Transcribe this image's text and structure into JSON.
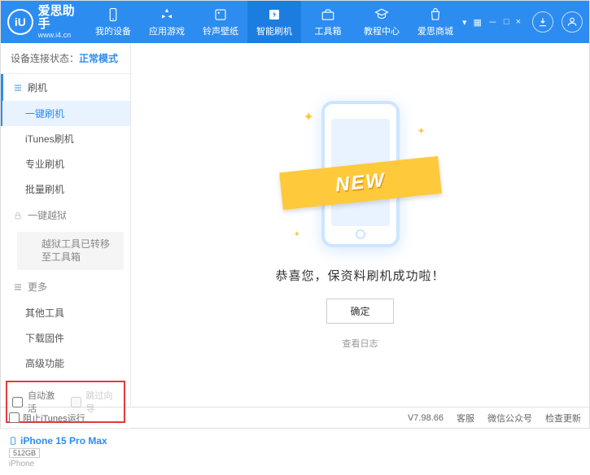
{
  "app": {
    "name": "爱思助手",
    "url": "www.i4.cn",
    "logoLetter": "iU"
  },
  "nav": {
    "items": [
      {
        "label": "我的设备"
      },
      {
        "label": "应用游戏"
      },
      {
        "label": "铃声壁纸"
      },
      {
        "label": "智能刷机"
      },
      {
        "label": "工具箱"
      },
      {
        "label": "教程中心"
      },
      {
        "label": "爱思商城"
      }
    ],
    "activeIndex": 3
  },
  "sidebar": {
    "connLabel": "设备连接状态：",
    "connMode": "正常模式",
    "group1": {
      "header": "刷机",
      "items": [
        "一键刷机",
        "iTunes刷机",
        "专业刷机",
        "批量刷机"
      ],
      "activeIndex": 0
    },
    "jailbreak": {
      "header": "一键越狱",
      "note": "越狱工具已转移至工具箱"
    },
    "more": {
      "header": "更多",
      "items": [
        "其他工具",
        "下载固件",
        "高级功能"
      ]
    },
    "checkbox1": "自动激活",
    "checkbox2": "跳过向导"
  },
  "device": {
    "name": "iPhone 15 Pro Max",
    "storage": "512GB",
    "type": "iPhone"
  },
  "main": {
    "ribbon": "NEW",
    "successMsg": "恭喜您，保资料刷机成功啦！",
    "okBtn": "确定",
    "viewLog": "查看日志"
  },
  "statusbar": {
    "blockItunes": "阻止iTunes运行",
    "version": "V7.98.66",
    "items": [
      "客服",
      "微信公众号",
      "检查更新"
    ]
  }
}
